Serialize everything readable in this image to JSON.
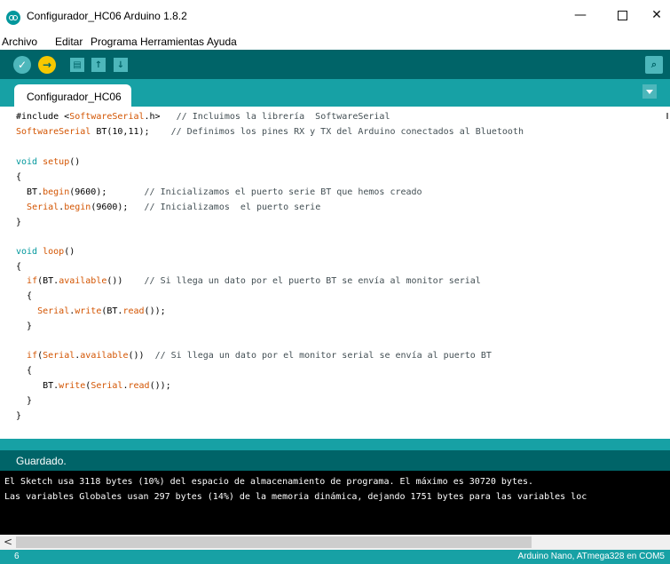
{
  "window": {
    "title": "Configurador_HC06 Arduino 1.8.2",
    "minimize_glyph": "—",
    "close_glyph": "✕"
  },
  "menu": [
    "Archivo",
    "Editar",
    "Programa",
    "Herramientas",
    "Ayuda"
  ],
  "toolbar": {
    "verify_glyph": "✓",
    "upload_glyph": "→",
    "new_glyph": "▤",
    "open_glyph": "↑",
    "save_glyph": "↓",
    "serial_glyph": "⌕",
    "icons": [
      "verify-icon",
      "upload-icon",
      "new-sketch-icon",
      "open-icon",
      "save-icon",
      "serial-monitor-icon"
    ]
  },
  "tab": {
    "label": "Configurador_HC06"
  },
  "code": {
    "l1": {
      "a": "#include <",
      "b": "SoftwareSerial",
      "c": ".h>   ",
      "d": "// Incluimos la librería  SoftwareSerial"
    },
    "l2": {
      "a": "SoftwareSerial",
      "b": " BT(10,11);    ",
      "c": "// Definimos los pines RX y TX del Arduino conectados al Bluetooth"
    },
    "l4": {
      "a": "void",
      "b": " ",
      "c": "setup",
      "d": "()"
    },
    "l5": "{",
    "l6": {
      "a": "  BT.",
      "b": "begin",
      "c": "(9600);       ",
      "d": "// Inicializamos el puerto serie BT que hemos creado"
    },
    "l7": {
      "a": "  ",
      "b": "Serial",
      "c": ".",
      "d": "begin",
      "e": "(9600);   ",
      "f": "// Inicializamos  el puerto serie"
    },
    "l8": "}",
    "l10": {
      "a": "void",
      "b": " ",
      "c": "loop",
      "d": "()"
    },
    "l11": "{",
    "l12": {
      "a": "  ",
      "b": "if",
      "c": "(BT.",
      "d": "available",
      "e": "())    ",
      "f": "// Si llega un dato por el puerto BT se envía al monitor serial"
    },
    "l13": "  {",
    "l14": {
      "a": "    ",
      "b": "Serial",
      "c": ".",
      "d": "write",
      "e": "(BT.",
      "f": "read",
      "g": "());"
    },
    "l15": "  }",
    "l17": {
      "a": "  ",
      "b": "if",
      "c": "(",
      "d": "Serial",
      "e": ".",
      "f": "available",
      "g": "())  ",
      "h": "// Si llega un dato por el monitor serial se envía al puerto BT"
    },
    "l18": "  {",
    "l19": {
      "a": "     BT.",
      "b": "write",
      "c": "(",
      "d": "Serial",
      "e": ".",
      "f": "read",
      "g": "());"
    },
    "l20": "  }",
    "l21": "}"
  },
  "status": {
    "message": "Guardado."
  },
  "console": {
    "lines": [
      "El Sketch usa 3118 bytes (10%) del espacio de almacenamiento de programa. El máximo es 30720 bytes.",
      "Las variables Globales usan 297 bytes (14%) de la memoria dinámica, dejando 1751 bytes para las variables loc"
    ]
  },
  "scrollbar": {
    "left_glyph": "<"
  },
  "footer": {
    "line_number": "6",
    "board": "Arduino Nano, ATmega328 en COM5"
  },
  "colors": {
    "toolbar": "#006468",
    "tabbar": "#17a1a5",
    "button": "#4db7bb",
    "upload": "#f7c800",
    "keyword": "#d35400",
    "type": "#00979c",
    "comment": "#434f54"
  }
}
